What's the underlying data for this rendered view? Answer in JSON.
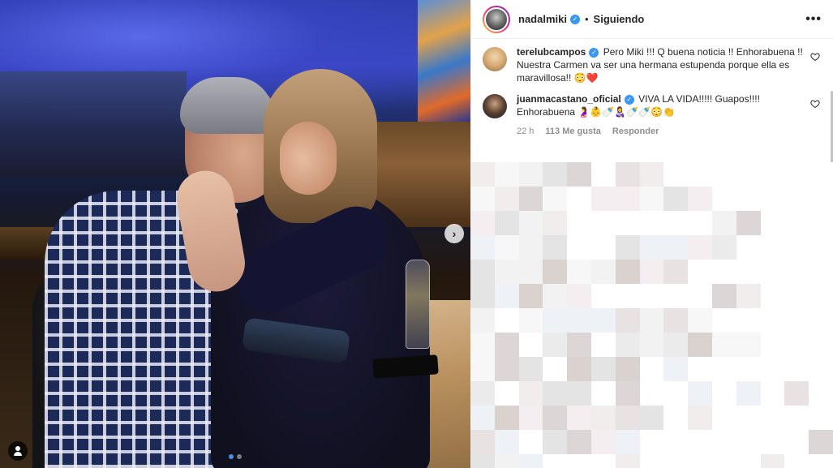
{
  "post": {
    "username": "nadalmiki",
    "separator": "•",
    "follow_status": "Siguiendo",
    "more_icon": "more-horizontal-icon",
    "carousel_dots": 2,
    "active_dot": 1
  },
  "comments": [
    {
      "username": "terelubcampos",
      "verified": true,
      "text": "Pero Miki !!! Q buena noticia !! Enhorabuena !! Nuestra Carmen va ser una hermana estupenda porque ella es maravillosa!! 😳❤️"
    },
    {
      "username": "juanmacastano_oficial",
      "verified": true,
      "text": "VIVA LA VIDA!!!!! Guapos!!!! Enhorabuena 🤰👶🍼👩‍🍼🍼🍼😳👏",
      "time": "22 h",
      "likes": "113 Me gusta",
      "reply_label": "Responder"
    }
  ],
  "colors": {
    "verified": "#3897f0",
    "text": "#262626",
    "muted": "#8e8e8e",
    "active_dot": "#4a90e2"
  }
}
